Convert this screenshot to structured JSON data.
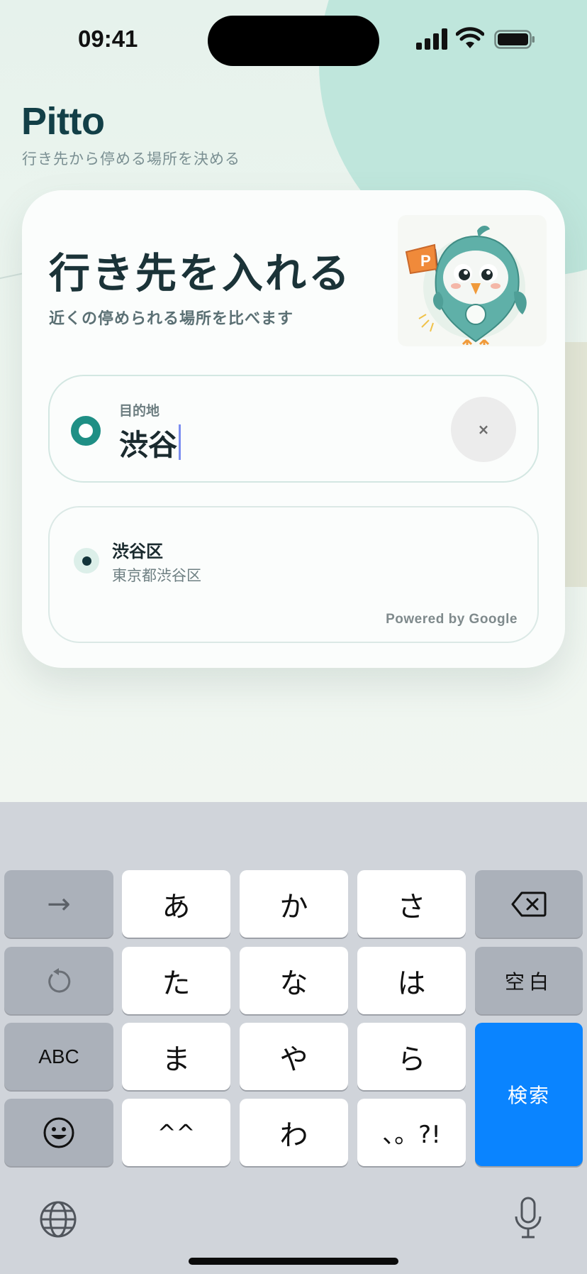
{
  "status_bar": {
    "time": "09:41"
  },
  "app": {
    "title": "Pitto",
    "subtitle": "行き先から停める場所を決める"
  },
  "card": {
    "title": "行き先を入れる",
    "subtitle": "近くの停められる場所を比べます",
    "mascot_flag_letter": "P",
    "input": {
      "label": "目的地",
      "value": "渋谷",
      "clear_label": "×"
    },
    "results": [
      {
        "name": "渋谷区",
        "address": "東京都渋谷区"
      }
    ],
    "attribution": "Powered by Google"
  },
  "keyboard": {
    "rows": [
      [
        "→",
        "あ",
        "か",
        "さ",
        "delete-icon"
      ],
      [
        "undo-icon",
        "た",
        "な",
        "は",
        "空白"
      ],
      [
        "ABC",
        "ま",
        "や",
        "ら"
      ],
      [
        "emoji-icon",
        "^^",
        "わ",
        "、。?!"
      ]
    ],
    "keys": {
      "arrow": "→",
      "a": "あ",
      "ka": "か",
      "sa": "さ",
      "ta": "た",
      "na": "な",
      "ha": "は",
      "space": "空白",
      "abc": "ABC",
      "ma": "ま",
      "ya": "や",
      "ra": "ら",
      "kaomoji": "^^",
      "wa": "わ",
      "punct": "、。?!",
      "search": "検索"
    },
    "icons": [
      "delete-icon",
      "undo-icon",
      "emoji-icon",
      "globe-icon",
      "microphone-icon"
    ],
    "accent_color": "#0a84ff"
  },
  "colors": {
    "brand": "#123f47",
    "teal": "#1f8f85",
    "mint_circle": "#bfe6dc"
  }
}
